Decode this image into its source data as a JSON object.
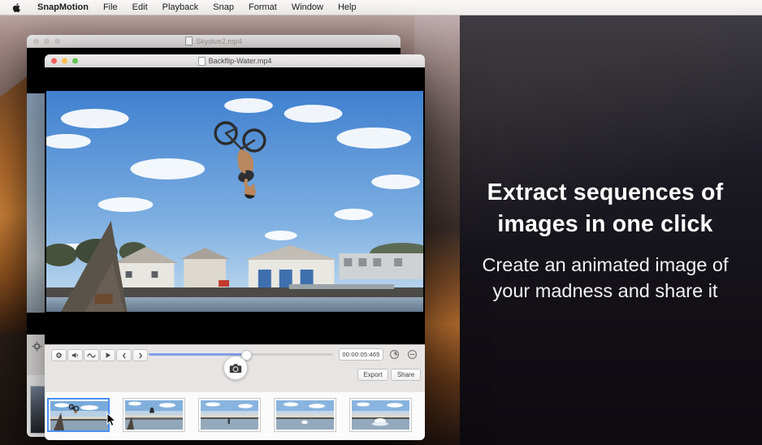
{
  "menu_bar": {
    "app_name": "SnapMotion",
    "items": [
      "File",
      "Edit",
      "Playback",
      "Snap",
      "Format",
      "Window",
      "Help"
    ]
  },
  "windows": {
    "background": {
      "title": "Skydive2.mp4"
    },
    "front": {
      "title": "Backflip-Water.mp4"
    }
  },
  "player": {
    "timecode": "00:00:05:465",
    "progress_percent": 53,
    "buttons": [
      "settings",
      "volume",
      "motion",
      "play",
      "step-back",
      "step-forward"
    ],
    "export_label": "Export",
    "share_label": "Share"
  },
  "filmstrip": {
    "frame_count": 5,
    "selected_index": 0
  },
  "marketing": {
    "headline": "Extract sequences of images in one click",
    "subheadline": "Create an animated image of your madness and share it"
  },
  "colors": {
    "selection_blue": "#4a90f2",
    "slider_blue": "#7f9ee8",
    "traffic_red": "#f5615c",
    "traffic_yellow": "#f6be4f",
    "traffic_green": "#62c554"
  }
}
